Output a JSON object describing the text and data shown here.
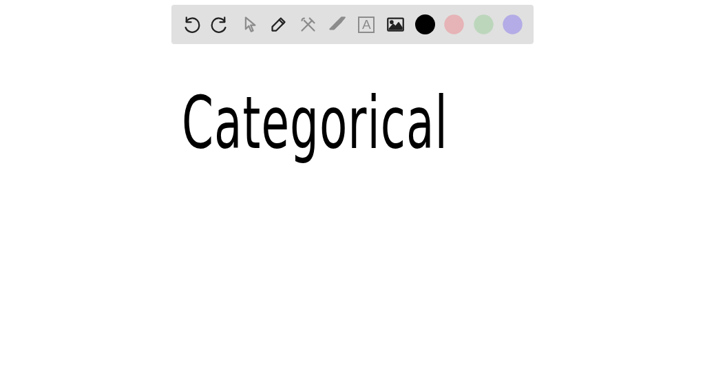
{
  "toolbar": {
    "tools": [
      {
        "kind": "undo",
        "disabled": false
      },
      {
        "kind": "redo",
        "disabled": false
      },
      {
        "kind": "select",
        "disabled": true
      },
      {
        "kind": "pen",
        "disabled": false
      },
      {
        "kind": "tools",
        "disabled": true
      },
      {
        "kind": "eraser",
        "disabled": true
      },
      {
        "kind": "text",
        "disabled": true,
        "glyph": "A"
      },
      {
        "kind": "image",
        "disabled": false
      }
    ],
    "colors": [
      {
        "color": "#000000",
        "selected": true
      },
      {
        "color": "#e6b3b6",
        "selected": false
      },
      {
        "color": "#bcd6bc",
        "selected": false
      },
      {
        "color": "#b3ace6",
        "selected": false
      }
    ]
  },
  "canvas": {
    "handwriting": "Categorical"
  }
}
